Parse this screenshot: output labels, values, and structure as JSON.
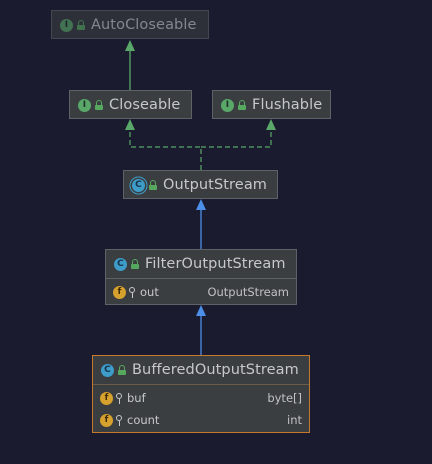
{
  "diagram": {
    "nodes": {
      "autocloseable": {
        "name": "AutoCloseable",
        "kind": "interface",
        "kind_letter": "I"
      },
      "closeable": {
        "name": "Closeable",
        "kind": "interface",
        "kind_letter": "I"
      },
      "flushable": {
        "name": "Flushable",
        "kind": "interface",
        "kind_letter": "I"
      },
      "outputstream": {
        "name": "OutputStream",
        "kind": "abstract class",
        "kind_letter": "C"
      },
      "filteroutputstream": {
        "name": "FilterOutputStream",
        "kind": "class",
        "kind_letter": "C",
        "fields": [
          {
            "badge": "f",
            "name": "out",
            "type": "OutputStream"
          }
        ]
      },
      "bufferedoutputstream": {
        "name": "BufferedOutputStream",
        "kind": "class",
        "kind_letter": "C",
        "selected": true,
        "fields": [
          {
            "badge": "f",
            "name": "buf",
            "type": "byte[]"
          },
          {
            "badge": "f",
            "name": "count",
            "type": "int"
          }
        ]
      }
    },
    "edges": [
      {
        "from": "closeable",
        "to": "autocloseable",
        "relation": "extends"
      },
      {
        "from": "outputstream",
        "to": "closeable",
        "relation": "implements"
      },
      {
        "from": "outputstream",
        "to": "flushable",
        "relation": "implements"
      },
      {
        "from": "filteroutputstream",
        "to": "outputstream",
        "relation": "extends"
      },
      {
        "from": "bufferedoutputstream",
        "to": "filteroutputstream",
        "relation": "extends"
      }
    ],
    "colors": {
      "background": "#1a1b2e",
      "node_fill": "#3b3e41",
      "node_border": "#5e6266",
      "selected_border": "#c37a2e",
      "interface_edge": "#59a869",
      "class_edge": "#4c8fe8",
      "interface_badge": "#59a869",
      "class_badge": "#3d9cc8",
      "field_badge": "#d6a12c"
    }
  }
}
